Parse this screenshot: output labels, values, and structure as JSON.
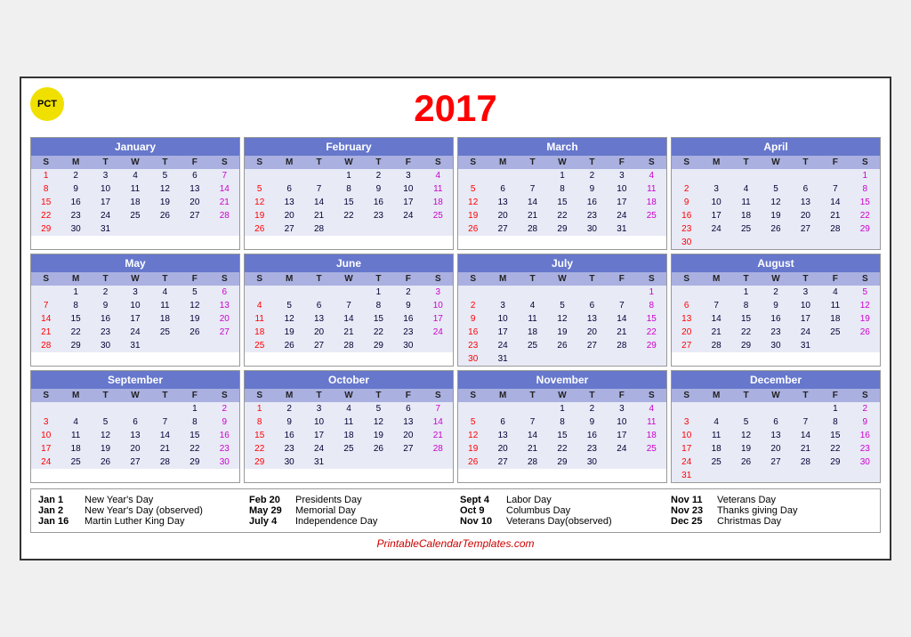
{
  "header": {
    "pct": "PCT",
    "year": "2017"
  },
  "months": [
    {
      "name": "January",
      "startDay": 0,
      "days": 31,
      "weeks": [
        [
          1,
          2,
          3,
          4,
          5,
          6,
          7
        ],
        [
          8,
          9,
          10,
          11,
          12,
          13,
          14
        ],
        [
          15,
          16,
          17,
          18,
          19,
          20,
          21
        ],
        [
          22,
          23,
          24,
          25,
          26,
          27,
          28
        ],
        [
          29,
          30,
          31,
          null,
          null,
          null,
          null
        ]
      ]
    },
    {
      "name": "February",
      "startDay": 3,
      "days": 28,
      "weeks": [
        [
          null,
          null,
          null,
          1,
          2,
          3,
          4
        ],
        [
          5,
          6,
          7,
          8,
          9,
          10,
          11
        ],
        [
          12,
          13,
          14,
          15,
          16,
          17,
          18
        ],
        [
          19,
          20,
          21,
          22,
          23,
          24,
          25
        ],
        [
          26,
          27,
          28,
          null,
          null,
          null,
          null
        ]
      ]
    },
    {
      "name": "March",
      "startDay": 3,
      "days": 31,
      "weeks": [
        [
          null,
          null,
          null,
          1,
          2,
          3,
          4
        ],
        [
          5,
          6,
          7,
          8,
          9,
          10,
          11
        ],
        [
          12,
          13,
          14,
          15,
          16,
          17,
          18
        ],
        [
          19,
          20,
          21,
          22,
          23,
          24,
          25
        ],
        [
          26,
          27,
          28,
          29,
          30,
          31,
          null
        ]
      ]
    },
    {
      "name": "April",
      "startDay": 6,
      "days": 30,
      "weeks": [
        [
          null,
          null,
          null,
          null,
          null,
          null,
          1
        ],
        [
          2,
          3,
          4,
          5,
          6,
          7,
          8
        ],
        [
          9,
          10,
          11,
          12,
          13,
          14,
          15
        ],
        [
          16,
          17,
          18,
          19,
          20,
          21,
          22
        ],
        [
          23,
          24,
          25,
          26,
          27,
          28,
          29
        ],
        [
          30,
          null,
          null,
          null,
          null,
          null,
          null
        ]
      ]
    },
    {
      "name": "May",
      "startDay": 1,
      "days": 31,
      "weeks": [
        [
          null,
          1,
          2,
          3,
          4,
          5,
          6
        ],
        [
          7,
          8,
          9,
          10,
          11,
          12,
          13
        ],
        [
          14,
          15,
          16,
          17,
          18,
          19,
          20
        ],
        [
          21,
          22,
          23,
          24,
          25,
          26,
          27
        ],
        [
          28,
          29,
          30,
          31,
          null,
          null,
          null
        ]
      ]
    },
    {
      "name": "June",
      "startDay": 4,
      "days": 30,
      "weeks": [
        [
          null,
          null,
          null,
          null,
          1,
          2,
          3
        ],
        [
          4,
          5,
          6,
          7,
          8,
          9,
          10
        ],
        [
          11,
          12,
          13,
          14,
          15,
          16,
          17
        ],
        [
          18,
          19,
          20,
          21,
          22,
          23,
          24
        ],
        [
          25,
          26,
          27,
          28,
          29,
          30,
          null
        ]
      ]
    },
    {
      "name": "July",
      "startDay": 6,
      "days": 31,
      "weeks": [
        [
          null,
          null,
          null,
          null,
          null,
          null,
          1
        ],
        [
          2,
          3,
          4,
          5,
          6,
          7,
          8
        ],
        [
          9,
          10,
          11,
          12,
          13,
          14,
          15
        ],
        [
          16,
          17,
          18,
          19,
          20,
          21,
          22
        ],
        [
          23,
          24,
          25,
          26,
          27,
          28,
          29
        ],
        [
          30,
          31,
          null,
          null,
          null,
          null,
          null
        ]
      ]
    },
    {
      "name": "August",
      "startDay": 2,
      "days": 31,
      "weeks": [
        [
          null,
          null,
          1,
          2,
          3,
          4,
          5
        ],
        [
          6,
          7,
          8,
          9,
          10,
          11,
          12
        ],
        [
          13,
          14,
          15,
          16,
          17,
          18,
          19
        ],
        [
          20,
          21,
          22,
          23,
          24,
          25,
          26
        ],
        [
          27,
          28,
          29,
          30,
          31,
          null,
          null
        ]
      ]
    },
    {
      "name": "September",
      "startDay": 5,
      "days": 30,
      "weeks": [
        [
          null,
          null,
          null,
          null,
          null,
          1,
          2
        ],
        [
          3,
          4,
          5,
          6,
          7,
          8,
          9
        ],
        [
          10,
          11,
          12,
          13,
          14,
          15,
          16
        ],
        [
          17,
          18,
          19,
          20,
          21,
          22,
          23
        ],
        [
          24,
          25,
          26,
          27,
          28,
          29,
          30
        ]
      ]
    },
    {
      "name": "October",
      "startDay": 0,
      "days": 31,
      "weeks": [
        [
          1,
          2,
          3,
          4,
          5,
          6,
          7
        ],
        [
          8,
          9,
          10,
          11,
          12,
          13,
          14
        ],
        [
          15,
          16,
          17,
          18,
          19,
          20,
          21
        ],
        [
          22,
          23,
          24,
          25,
          26,
          27,
          28
        ],
        [
          29,
          30,
          31,
          null,
          null,
          null,
          null
        ]
      ]
    },
    {
      "name": "November",
      "startDay": 3,
      "days": 30,
      "weeks": [
        [
          null,
          null,
          null,
          1,
          2,
          3,
          4
        ],
        [
          5,
          6,
          7,
          8,
          9,
          10,
          11
        ],
        [
          12,
          13,
          14,
          15,
          16,
          17,
          18
        ],
        [
          19,
          20,
          21,
          22,
          23,
          24,
          25
        ],
        [
          26,
          27,
          28,
          29,
          30,
          null,
          null
        ]
      ]
    },
    {
      "name": "December",
      "startDay": 5,
      "days": 31,
      "weeks": [
        [
          null,
          null,
          null,
          null,
          null,
          1,
          2
        ],
        [
          3,
          4,
          5,
          6,
          7,
          8,
          9
        ],
        [
          10,
          11,
          12,
          13,
          14,
          15,
          16
        ],
        [
          17,
          18,
          19,
          20,
          21,
          22,
          23
        ],
        [
          24,
          25,
          26,
          27,
          28,
          29,
          30
        ],
        [
          31,
          null,
          null,
          null,
          null,
          null,
          null
        ]
      ]
    }
  ],
  "dayLabels": [
    "S",
    "M",
    "T",
    "W",
    "T",
    "F",
    "S"
  ],
  "holidays": [
    [
      {
        "date": "Jan 1",
        "name": "New Year's Day"
      },
      {
        "date": "Jan 2",
        "name": "New Year's Day (observed)"
      },
      {
        "date": "Jan 16",
        "name": "Martin Luther King Day"
      }
    ],
    [
      {
        "date": "Feb 20",
        "name": "Presidents Day"
      },
      {
        "date": "May 29",
        "name": "Memorial Day"
      },
      {
        "date": "July 4",
        "name": "Independence Day"
      }
    ],
    [
      {
        "date": "Sept 4",
        "name": "Labor Day"
      },
      {
        "date": "Oct 9",
        "name": "Columbus Day"
      },
      {
        "date": "Nov 10",
        "name": "Veterans Day(observed)"
      }
    ],
    [
      {
        "date": "Nov 11",
        "name": "Veterans Day"
      },
      {
        "date": "Nov 23",
        "name": "Thanks giving Day"
      },
      {
        "date": "Dec 25",
        "name": "Christmas Day"
      }
    ]
  ],
  "footer": {
    "url": "PrintableCalendarTemplates.com"
  }
}
